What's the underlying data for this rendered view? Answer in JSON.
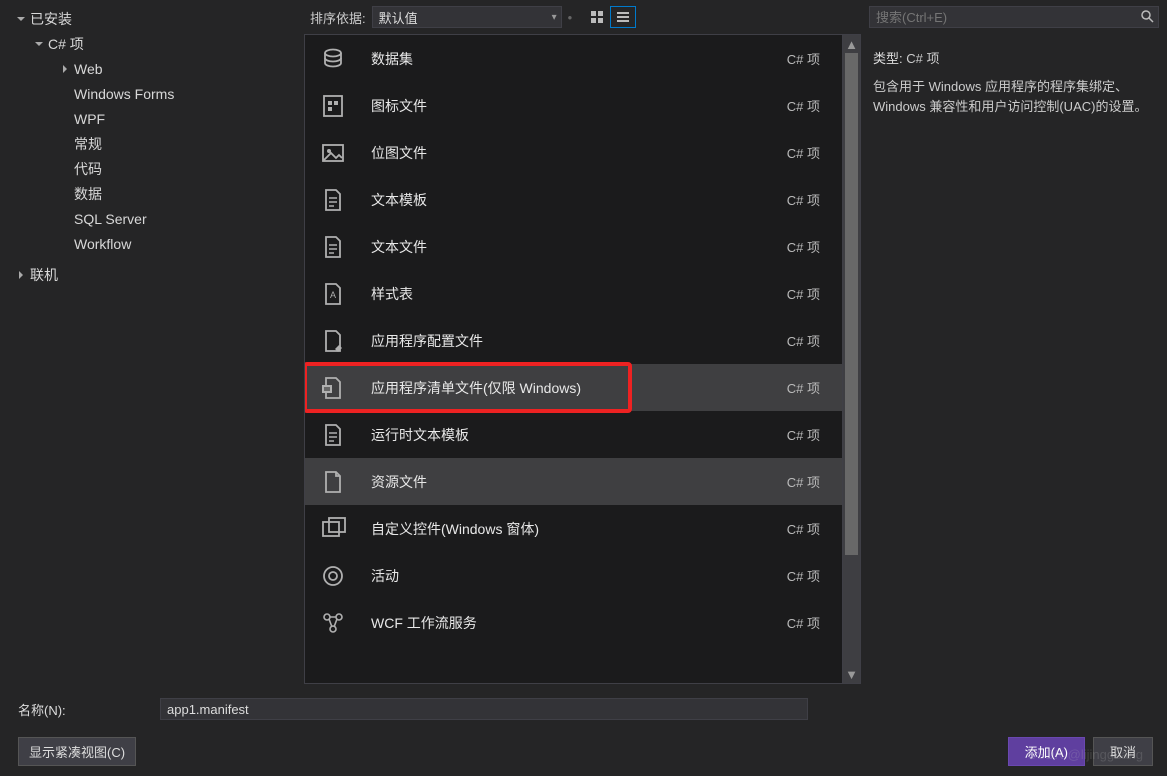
{
  "sidebar": {
    "installed": "已安装",
    "csharp": "C# 项",
    "items": [
      "Web",
      "Windows Forms",
      "WPF",
      "常规",
      "代码",
      "数据",
      "SQL Server",
      "Workflow"
    ],
    "online": "联机"
  },
  "sortbar": {
    "label": "排序依据:",
    "value": "默认值"
  },
  "templates": [
    {
      "name": "数据集",
      "lang": "C# 项",
      "icon": "dataset"
    },
    {
      "name": "图标文件",
      "lang": "C# 项",
      "icon": "iconfile"
    },
    {
      "name": "位图文件",
      "lang": "C# 项",
      "icon": "image"
    },
    {
      "name": "文本模板",
      "lang": "C# 项",
      "icon": "doc"
    },
    {
      "name": "文本文件",
      "lang": "C# 项",
      "icon": "doc"
    },
    {
      "name": "样式表",
      "lang": "C# 项",
      "icon": "stylesheet"
    },
    {
      "name": "应用程序配置文件",
      "lang": "C# 项",
      "icon": "config"
    },
    {
      "name": "应用程序清单文件(仅限 Windows)",
      "lang": "C# 项",
      "icon": "manifest",
      "selected": true,
      "highlighted": true
    },
    {
      "name": "运行时文本模板",
      "lang": "C# 项",
      "icon": "doc"
    },
    {
      "name": "资源文件",
      "lang": "C# 项",
      "icon": "resource",
      "hover": true
    },
    {
      "name": "自定义控件(Windows 窗体)",
      "lang": "C# 项",
      "icon": "control"
    },
    {
      "name": "活动",
      "lang": "C# 项",
      "icon": "activity"
    },
    {
      "name": "WCF 工作流服务",
      "lang": "C# 项",
      "icon": "workflow"
    }
  ],
  "details": {
    "search_placeholder": "搜索(Ctrl+E)",
    "type_label": "类型:",
    "type_value": "C# 项",
    "description": "包含用于 Windows 应用程序的程序集绑定、Windows 兼容性和用户访问控制(UAC)的设置。"
  },
  "bottom": {
    "name_label": "名称(N):",
    "name_value": "app1.manifest",
    "compact": "显示紧凑视图(C)",
    "add": "添加(A)",
    "cancel": "取消"
  },
  "watermark": "CSDN @lijingguang"
}
